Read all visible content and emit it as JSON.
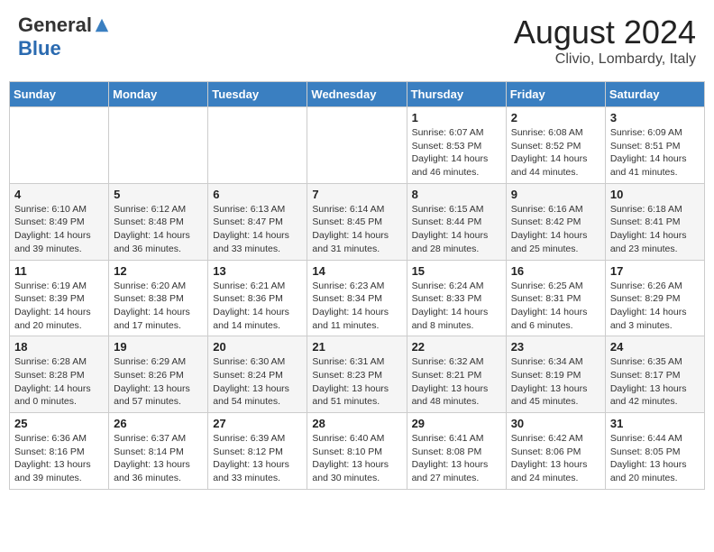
{
  "header": {
    "logo_general": "General",
    "logo_blue": "Blue",
    "month_year": "August 2024",
    "location": "Clivio, Lombardy, Italy"
  },
  "days_of_week": [
    "Sunday",
    "Monday",
    "Tuesday",
    "Wednesday",
    "Thursday",
    "Friday",
    "Saturday"
  ],
  "weeks": [
    [
      {
        "day": "",
        "info": ""
      },
      {
        "day": "",
        "info": ""
      },
      {
        "day": "",
        "info": ""
      },
      {
        "day": "",
        "info": ""
      },
      {
        "day": "1",
        "info": "Sunrise: 6:07 AM\nSunset: 8:53 PM\nDaylight: 14 hours\nand 46 minutes."
      },
      {
        "day": "2",
        "info": "Sunrise: 6:08 AM\nSunset: 8:52 PM\nDaylight: 14 hours\nand 44 minutes."
      },
      {
        "day": "3",
        "info": "Sunrise: 6:09 AM\nSunset: 8:51 PM\nDaylight: 14 hours\nand 41 minutes."
      }
    ],
    [
      {
        "day": "4",
        "info": "Sunrise: 6:10 AM\nSunset: 8:49 PM\nDaylight: 14 hours\nand 39 minutes."
      },
      {
        "day": "5",
        "info": "Sunrise: 6:12 AM\nSunset: 8:48 PM\nDaylight: 14 hours\nand 36 minutes."
      },
      {
        "day": "6",
        "info": "Sunrise: 6:13 AM\nSunset: 8:47 PM\nDaylight: 14 hours\nand 33 minutes."
      },
      {
        "day": "7",
        "info": "Sunrise: 6:14 AM\nSunset: 8:45 PM\nDaylight: 14 hours\nand 31 minutes."
      },
      {
        "day": "8",
        "info": "Sunrise: 6:15 AM\nSunset: 8:44 PM\nDaylight: 14 hours\nand 28 minutes."
      },
      {
        "day": "9",
        "info": "Sunrise: 6:16 AM\nSunset: 8:42 PM\nDaylight: 14 hours\nand 25 minutes."
      },
      {
        "day": "10",
        "info": "Sunrise: 6:18 AM\nSunset: 8:41 PM\nDaylight: 14 hours\nand 23 minutes."
      }
    ],
    [
      {
        "day": "11",
        "info": "Sunrise: 6:19 AM\nSunset: 8:39 PM\nDaylight: 14 hours\nand 20 minutes."
      },
      {
        "day": "12",
        "info": "Sunrise: 6:20 AM\nSunset: 8:38 PM\nDaylight: 14 hours\nand 17 minutes."
      },
      {
        "day": "13",
        "info": "Sunrise: 6:21 AM\nSunset: 8:36 PM\nDaylight: 14 hours\nand 14 minutes."
      },
      {
        "day": "14",
        "info": "Sunrise: 6:23 AM\nSunset: 8:34 PM\nDaylight: 14 hours\nand 11 minutes."
      },
      {
        "day": "15",
        "info": "Sunrise: 6:24 AM\nSunset: 8:33 PM\nDaylight: 14 hours\nand 8 minutes."
      },
      {
        "day": "16",
        "info": "Sunrise: 6:25 AM\nSunset: 8:31 PM\nDaylight: 14 hours\nand 6 minutes."
      },
      {
        "day": "17",
        "info": "Sunrise: 6:26 AM\nSunset: 8:29 PM\nDaylight: 14 hours\nand 3 minutes."
      }
    ],
    [
      {
        "day": "18",
        "info": "Sunrise: 6:28 AM\nSunset: 8:28 PM\nDaylight: 14 hours\nand 0 minutes."
      },
      {
        "day": "19",
        "info": "Sunrise: 6:29 AM\nSunset: 8:26 PM\nDaylight: 13 hours\nand 57 minutes."
      },
      {
        "day": "20",
        "info": "Sunrise: 6:30 AM\nSunset: 8:24 PM\nDaylight: 13 hours\nand 54 minutes."
      },
      {
        "day": "21",
        "info": "Sunrise: 6:31 AM\nSunset: 8:23 PM\nDaylight: 13 hours\nand 51 minutes."
      },
      {
        "day": "22",
        "info": "Sunrise: 6:32 AM\nSunset: 8:21 PM\nDaylight: 13 hours\nand 48 minutes."
      },
      {
        "day": "23",
        "info": "Sunrise: 6:34 AM\nSunset: 8:19 PM\nDaylight: 13 hours\nand 45 minutes."
      },
      {
        "day": "24",
        "info": "Sunrise: 6:35 AM\nSunset: 8:17 PM\nDaylight: 13 hours\nand 42 minutes."
      }
    ],
    [
      {
        "day": "25",
        "info": "Sunrise: 6:36 AM\nSunset: 8:16 PM\nDaylight: 13 hours\nand 39 minutes."
      },
      {
        "day": "26",
        "info": "Sunrise: 6:37 AM\nSunset: 8:14 PM\nDaylight: 13 hours\nand 36 minutes."
      },
      {
        "day": "27",
        "info": "Sunrise: 6:39 AM\nSunset: 8:12 PM\nDaylight: 13 hours\nand 33 minutes."
      },
      {
        "day": "28",
        "info": "Sunrise: 6:40 AM\nSunset: 8:10 PM\nDaylight: 13 hours\nand 30 minutes."
      },
      {
        "day": "29",
        "info": "Sunrise: 6:41 AM\nSunset: 8:08 PM\nDaylight: 13 hours\nand 27 minutes."
      },
      {
        "day": "30",
        "info": "Sunrise: 6:42 AM\nSunset: 8:06 PM\nDaylight: 13 hours\nand 24 minutes."
      },
      {
        "day": "31",
        "info": "Sunrise: 6:44 AM\nSunset: 8:05 PM\nDaylight: 13 hours\nand 20 minutes."
      }
    ]
  ]
}
